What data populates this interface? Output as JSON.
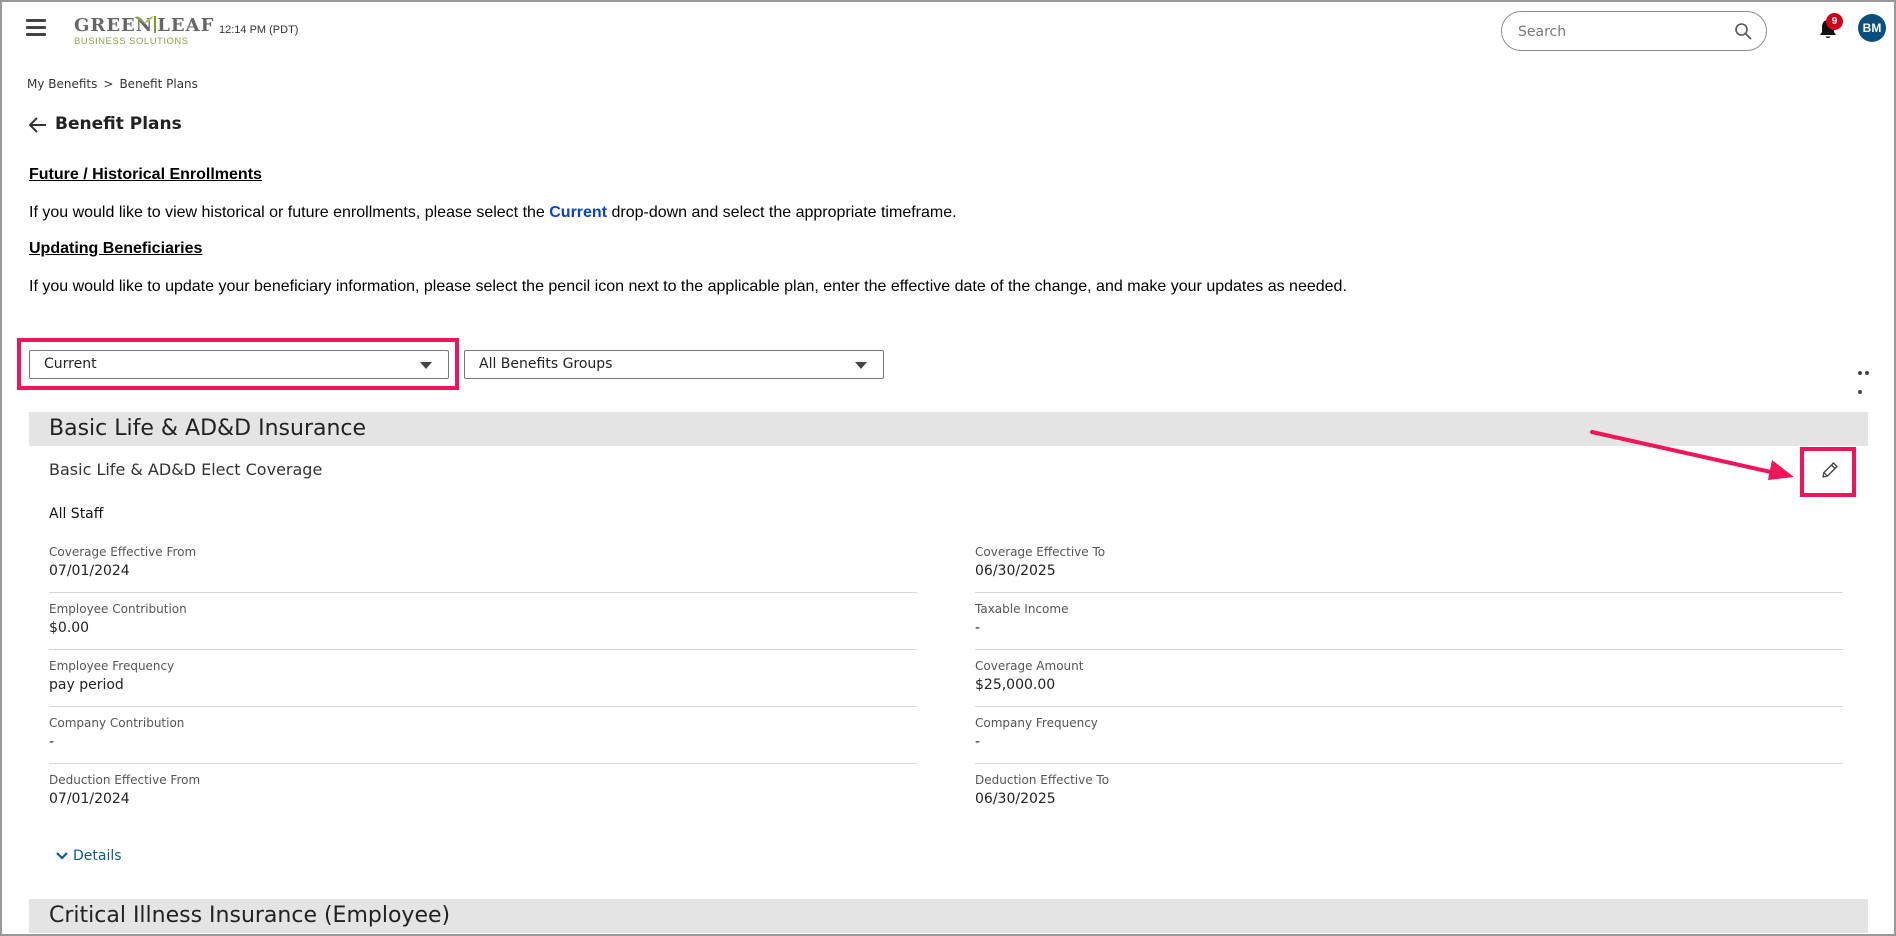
{
  "header": {
    "logo_top": "GREEN LEAF",
    "logo_left": "GREEN",
    "logo_right": "LEAF",
    "logo_sub": "BUSINESS SOLUTIONS",
    "time": "12:14 PM (PDT)",
    "search_placeholder": "Search",
    "notification_count": "9",
    "avatar_initials": "BM"
  },
  "breadcrumb": {
    "items": [
      "My Benefits",
      "Benefit Plans"
    ],
    "separator": ">"
  },
  "page_title": "Benefit Plans",
  "instructions": {
    "future_heading": "Future / Historical Enrollments",
    "future_text_1": "If you would like to view historical or future enrollments, please select the ",
    "future_keyword": "Current",
    "future_text_2": " drop-down and select the appropriate timeframe.",
    "beneficiary_heading": "Updating Beneficiaries",
    "beneficiary_text": "If you would like to update your beneficiary information, please select the pencil icon next to the applicable plan, enter the effective date of the change, and make your updates as needed."
  },
  "filters": {
    "timeframe_value": "Current",
    "group_value": "All Benefits Groups"
  },
  "plans": [
    {
      "title": "Basic Life & AD&D Insurance",
      "subtitle": "Basic Life & AD&D Elect Coverage",
      "group": "All Staff",
      "fields_left": [
        {
          "label": "Coverage Effective From",
          "value": "07/01/2024"
        },
        {
          "label": "Employee Contribution",
          "value": "$0.00"
        },
        {
          "label": "Employee Frequency",
          "value": "pay period"
        },
        {
          "label": "Company Contribution",
          "value": "-"
        },
        {
          "label": "Deduction Effective From",
          "value": "07/01/2024"
        }
      ],
      "fields_right": [
        {
          "label": "Coverage Effective To",
          "value": "06/30/2025"
        },
        {
          "label": "Taxable Income",
          "value": "-"
        },
        {
          "label": "Coverage Amount",
          "value": "$25,000.00"
        },
        {
          "label": "Company Frequency",
          "value": "-"
        },
        {
          "label": "Deduction Effective To",
          "value": "06/30/2025"
        }
      ],
      "details_label": "Details"
    },
    {
      "title": "Critical Illness Insurance (Employee)"
    }
  ],
  "colors": {
    "highlight": "#f0145a",
    "link": "#0b5b8f",
    "keyword": "#0a3fcf",
    "badge": "#d0021b",
    "avatar": "#0b4f7c"
  },
  "icons": [
    "hamburger-menu-icon",
    "search-icon",
    "bell-icon",
    "back-arrow-icon",
    "chevron-down-icon",
    "more-options-icon",
    "pencil-icon",
    "leaf-icon"
  ]
}
